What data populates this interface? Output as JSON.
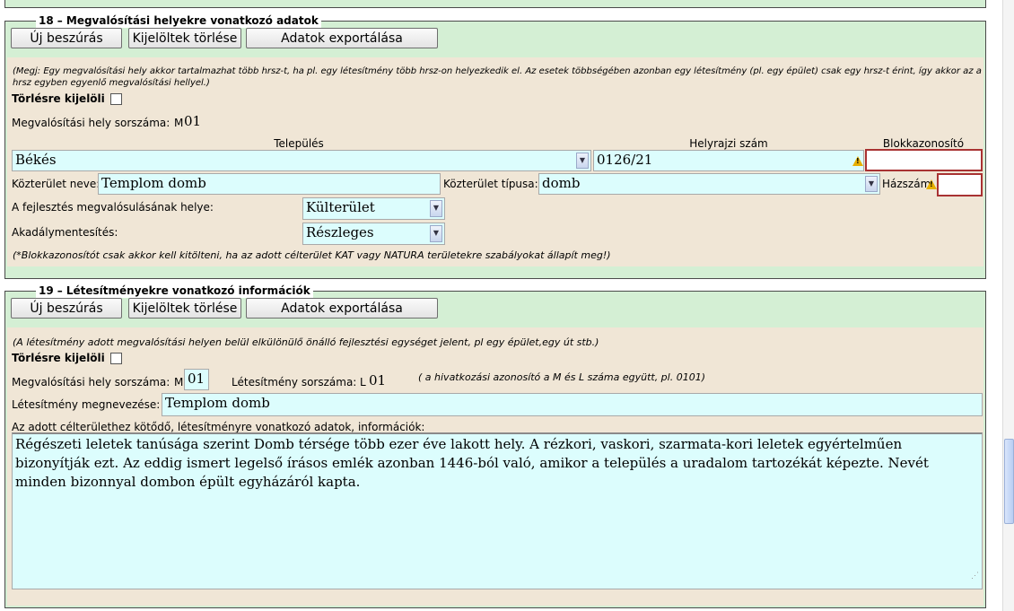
{
  "section18": {
    "number": "18",
    "title": "– Megvalósítási helyekre vonatkozó adatok",
    "buttons": {
      "insert": "Új beszúrás",
      "delete_selected": "Kijelöltek törlése",
      "export": "Adatok exportálása"
    },
    "note": "(Megj: Egy megvalósítási hely akkor tartalmazhat több hrsz-t, ha pl. egy létesítmény több hrsz-on helyezkedik el. Az esetek többségében azonban egy létesítmény (pl. egy épület) csak egy hrsz-t érint, így akkor az a hrsz egyben egyenlő megvalósítási hellyel.)",
    "mark_delete_label": "Törlésre kijelöli",
    "site_number_label": "Megvalósítási hely sorszáma:",
    "site_prefix": "M",
    "site_number": "01",
    "col_settlement": "Település",
    "col_parcel": "Helyrajzi szám",
    "col_block": "Blokkazonosító",
    "settlement_value": "Békés",
    "parcel_value": "0126/21",
    "block_value": "",
    "street_name_label": "Közterület neve:",
    "street_name_value": "Templom domb",
    "street_type_label": "Közterület típusa:",
    "street_type_value": "domb",
    "house_number_label": "Házszám",
    "house_number_value": "",
    "location_label": "A fejlesztés megvalósulásának helye:",
    "location_value": "Külterület",
    "accessibility_label": "Akadálymentesítés:",
    "accessibility_value": "Részleges",
    "footnote": "(*Blokkazonosítót csak akkor kell kitölteni, ha az adott célterület KAT vagy NATURA területekre szabályokat állapít meg!)"
  },
  "section19": {
    "number": "19",
    "title": "– Létesítményekre vonatkozó információk",
    "buttons": {
      "insert": "Új beszúrás",
      "delete_selected": "Kijelöltek törlése",
      "export": "Adatok exportálása"
    },
    "note": "(A létesítmény adott megvalósítási helyen belül elkülönülő önálló fejlesztési egységet jelent, pl egy épület,egy út stb.)",
    "mark_delete_label": "Törlésre kijelöli",
    "site_number_label": "Megvalósítási hely sorszáma:",
    "site_prefix": "M",
    "site_number_value": "01",
    "facility_number_label": "Létesítmény sorszáma:",
    "facility_prefix": "L",
    "facility_number": "01",
    "reference_hint": "( a hivatkozási azonosító a M és L száma együtt, pl. 0101)",
    "facility_name_label": "Létesítmény megnevezése:",
    "facility_name_value": "Templom domb",
    "details_label": "Az adott célterülethez kötődő, létesítményre vonatkozó adatok, információk:",
    "details_value": "Régészeti leletek tanúsága szerint Domb térsége több ezer éve lakott hely. A rézkori, vaskori, szarmata-kori leletek egyértelműen bizonyítják ezt. Az eddig ismert legelső írásos emlék azonban 1446-ból való, amikor a település a uradalom tartozékát képezte. Nevét minden bizonnyal dombon épült egyházáról kapta."
  },
  "colors": {
    "panel_green": "#d4efd4",
    "inner_beige": "#f0e6d6",
    "field_cyan": "#dcfdfd",
    "required_red": "#a83232",
    "warning_yellow": "#e8b000"
  },
  "icons": {
    "warning": "warning-triangle-icon",
    "dropdown": "chevron-down-icon",
    "resize": "resize-grip-icon"
  }
}
